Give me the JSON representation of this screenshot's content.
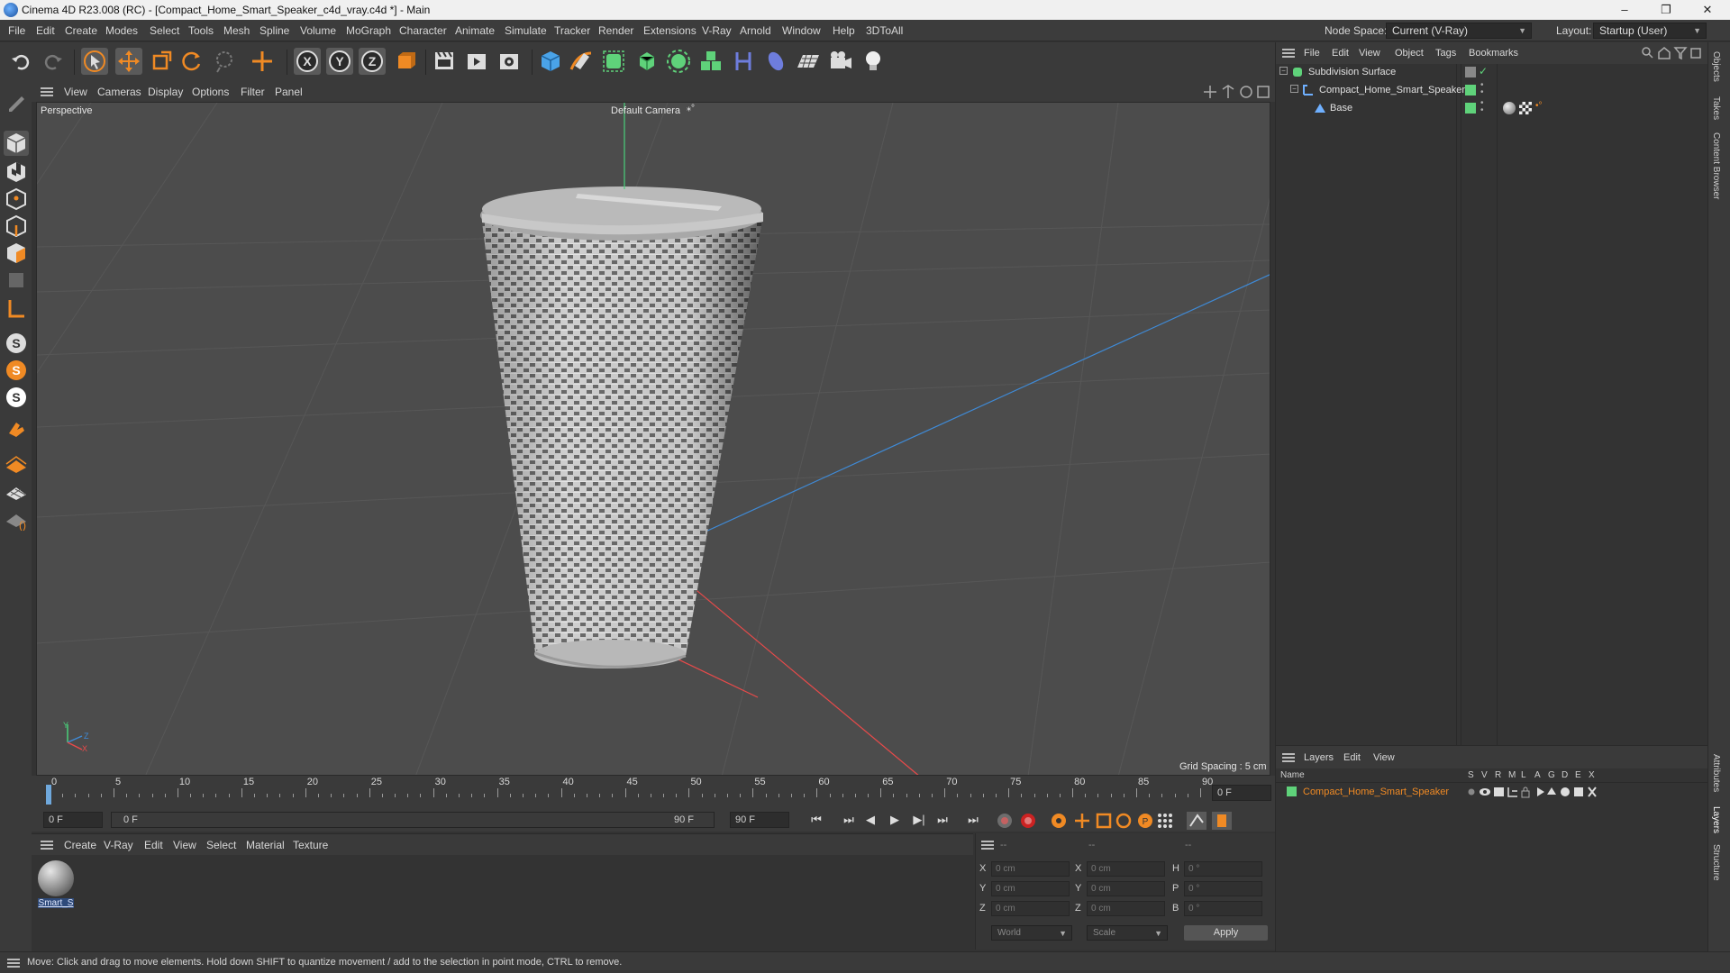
{
  "window": {
    "title": "Cinema 4D R23.008 (RC) - [Compact_Home_Smart_Speaker_c4d_vray.c4d *] - Main",
    "controls": [
      "–",
      "❐",
      "✕"
    ]
  },
  "menubar": {
    "items": [
      "File",
      "Edit",
      "Create",
      "Modes",
      "Select",
      "Tools",
      "Mesh",
      "Spline",
      "Volume",
      "MoGraph",
      "Character",
      "Animate",
      "Simulate",
      "Tracker",
      "Render",
      "Extensions",
      "V-Ray",
      "Arnold",
      "Window",
      "Help",
      "3DToAll"
    ],
    "node_space_label": "Node Space:",
    "node_space_value": "Current (V-Ray)",
    "layout_label": "Layout:",
    "layout_value": "Startup (User)"
  },
  "viewport": {
    "menu": [
      "View",
      "Cameras",
      "Display",
      "Options",
      "Filter",
      "Panel"
    ],
    "view_name": "Perspective",
    "camera_label": "Default Camera",
    "grid_spacing": "Grid Spacing : 5 cm",
    "axis": {
      "y": "Y",
      "z": "Z",
      "x": "X"
    }
  },
  "timeline": {
    "ticks": [
      "0",
      "5",
      "10",
      "15",
      "20",
      "25",
      "30",
      "35",
      "40",
      "45",
      "50",
      "55",
      "60",
      "65",
      "70",
      "75",
      "80",
      "85",
      "90"
    ],
    "current_frame_right": "0 F",
    "start_field": "0 F",
    "range_start": "0 F",
    "range_end": "90 F",
    "end_field": "90 F"
  },
  "material_manager": {
    "menu": [
      "Create",
      "V-Ray",
      "Edit",
      "View",
      "Select",
      "Material",
      "Texture"
    ],
    "materials": [
      {
        "name": "Smart_S"
      }
    ]
  },
  "coordinates": {
    "header": [
      "--",
      "--",
      "--"
    ],
    "rows": [
      {
        "pos_label": "X",
        "pos": "0 cm",
        "size_label": "X",
        "size": "0 cm",
        "rot_label": "H",
        "rot": "0 °"
      },
      {
        "pos_label": "Y",
        "pos": "0 cm",
        "size_label": "Y",
        "size": "0 cm",
        "rot_label": "P",
        "rot": "0 °"
      },
      {
        "pos_label": "Z",
        "pos": "0 cm",
        "size_label": "Z",
        "size": "0 cm",
        "rot_label": "B",
        "rot": "0 °"
      }
    ],
    "mode_world": "World",
    "mode_scale": "Scale",
    "apply": "Apply"
  },
  "object_manager": {
    "menu": [
      "File",
      "Edit",
      "View",
      "Object",
      "Tags",
      "Bookmarks"
    ],
    "objects": [
      {
        "name": "Subdivision Surface",
        "indent": 0
      },
      {
        "name": "Compact_Home_Smart_Speaker",
        "indent": 1
      },
      {
        "name": "Base",
        "indent": 2
      }
    ]
  },
  "layer_manager": {
    "menu": [
      "Layers",
      "Edit",
      "View"
    ],
    "columns": [
      "Name",
      "S",
      "V",
      "R",
      "M",
      "L",
      "A",
      "G",
      "D",
      "E",
      "X"
    ],
    "layers": [
      {
        "name": "Compact_Home_Smart_Speaker",
        "color": "#5fd27a"
      }
    ]
  },
  "side_tabs": [
    "Objects",
    "Takes",
    "Content Browser",
    "Attributes",
    "Layers",
    "Structure"
  ],
  "status": {
    "text": "Move: Click and drag to move elements. Hold down SHIFT to quantize movement / add to the selection in point mode, CTRL to remove."
  },
  "colors": {
    "accent_orange": "#f08a24",
    "layer_green": "#5fd27a",
    "axis_x": "#e84a4a",
    "axis_y": "#4ad07a",
    "axis_z": "#3f8ad6"
  }
}
